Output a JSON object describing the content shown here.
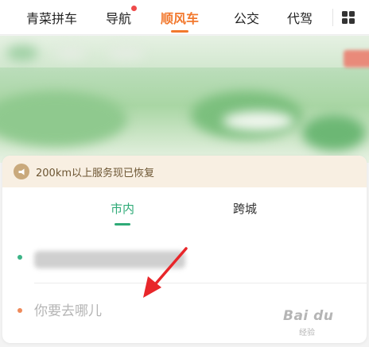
{
  "topnav": {
    "tabs": [
      {
        "label": "青菜拼车",
        "active": false
      },
      {
        "label": "导航",
        "active": false,
        "badge_dot": true
      },
      {
        "label": "顺风车",
        "active": true
      },
      {
        "label": "公交",
        "active": false
      },
      {
        "label": "代驾",
        "active": false
      }
    ],
    "more_icon": "grid-icon"
  },
  "notice": {
    "icon": "megaphone-icon",
    "text": "200km以上服务现已恢复"
  },
  "subtabs": [
    {
      "label": "市内",
      "active": true
    },
    {
      "label": "跨城",
      "active": false
    }
  ],
  "origin": {
    "value_blurred": true
  },
  "destination": {
    "placeholder": "你要去哪儿"
  },
  "watermark": {
    "brand": "Bai du",
    "sub": "经验"
  },
  "colors": {
    "accent_orange": "#f2782d",
    "accent_green": "#2eaa77",
    "notice_bg": "#f8efe2",
    "arrow": "#e8262a"
  }
}
